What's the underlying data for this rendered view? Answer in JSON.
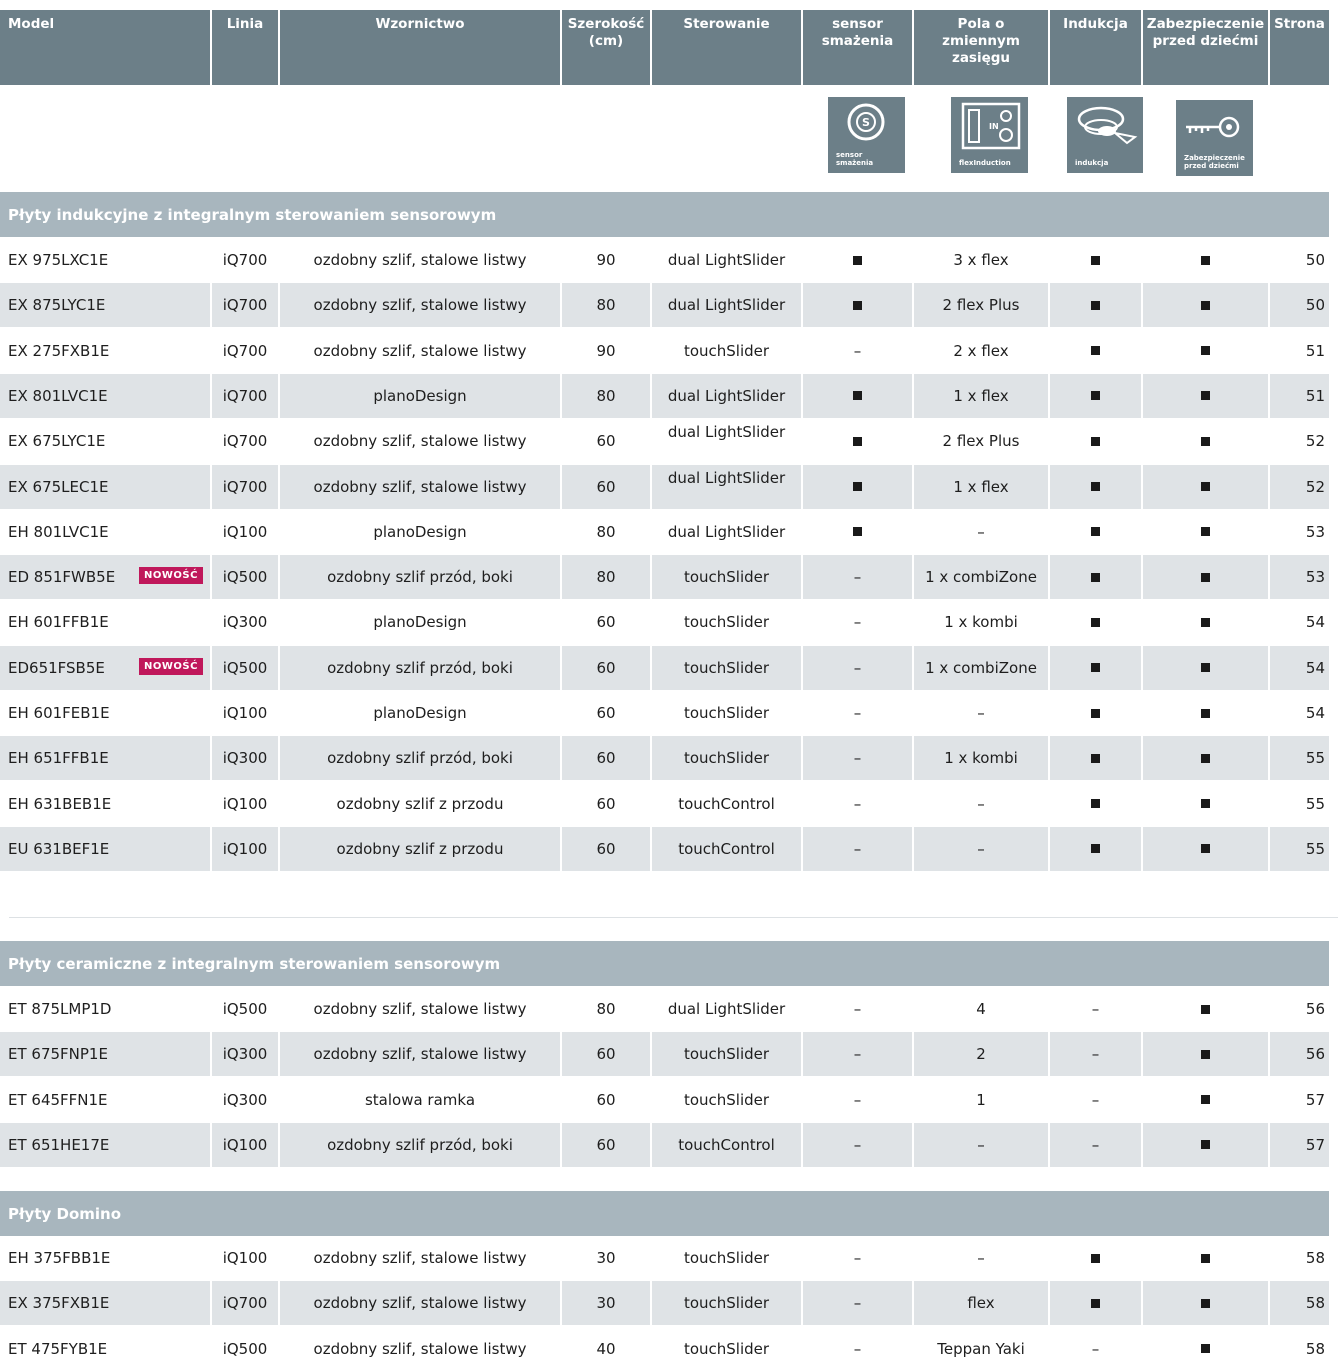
{
  "header": {
    "columns": [
      {
        "key": "model",
        "label": "Model"
      },
      {
        "key": "linia",
        "label": "Linia"
      },
      {
        "key": "wzornictwo",
        "label": "Wzornictwo"
      },
      {
        "key": "szerokosc",
        "label": "Szerokość (cm)"
      },
      {
        "key": "sterowanie",
        "label": "Sterowanie"
      },
      {
        "key": "sensor",
        "label": "sensor smażenia"
      },
      {
        "key": "pola",
        "label": "Pola o zmiennym zasięgu"
      },
      {
        "key": "indukcja",
        "label": "Indukcja"
      },
      {
        "key": "zabezpieczenie",
        "label": "Zabezpieczenie przed dziećmi"
      },
      {
        "key": "strona",
        "label": "Strona"
      }
    ]
  },
  "icons": {
    "sensor": {
      "icon": "sensor-smazenia-icon",
      "caption": "sensor smażenia"
    },
    "flex": {
      "icon": "flexinduction-icon",
      "caption": "flexInduction"
    },
    "indukcja": {
      "icon": "indukcja-icon",
      "caption": "indukcja"
    },
    "zabezpieczenie": {
      "icon": "key-lock-icon",
      "caption": "Zabezpieczenie przed dziećmi"
    }
  },
  "markers": {
    "yes": "■",
    "no": "–"
  },
  "badge_text": "NOWOŚĆ",
  "sections": [
    {
      "title": "Płyty indukcyjne z integralnym sterowaniem sensorowym",
      "rows": [
        {
          "model": "EX 975LXC1E",
          "linia": "iQ700",
          "wzornictwo": "ozdobny szlif, stalowe listwy",
          "szerokosc": "90",
          "sterowanie": "dual LightSlider",
          "sensor": "■",
          "pola": "3 x flex",
          "indukcja": "■",
          "zabezpieczenie": "■",
          "strona": "50"
        },
        {
          "model": "EX 875LYC1E",
          "linia": "iQ700",
          "wzornictwo": "ozdobny szlif, stalowe listwy",
          "szerokosc": "80",
          "sterowanie": "dual LightSlider",
          "sensor": "■",
          "pola": "2 flex Plus",
          "indukcja": "■",
          "zabezpieczenie": "■",
          "strona": "50"
        },
        {
          "model": "EX 275FXB1E",
          "linia": "iQ700",
          "wzornictwo": "ozdobny szlif, stalowe listwy",
          "szerokosc": "90",
          "sterowanie": "touchSlider",
          "sensor": "–",
          "pola": "2 x flex",
          "indukcja": "■",
          "zabezpieczenie": "■",
          "strona": "51"
        },
        {
          "model": "EX 801LVC1E",
          "linia": "iQ700",
          "wzornictwo": "planoDesign",
          "szerokosc": "80",
          "sterowanie": "dual LightSlider",
          "sensor": "■",
          "pola": "1 x flex",
          "indukcja": "■",
          "zabezpieczenie": "■",
          "strona": "51"
        },
        {
          "model": "EX 675LYC1E",
          "linia": "iQ700",
          "wzornictwo": "ozdobny szlif, stalowe listwy",
          "szerokosc": "60",
          "sterowanie": "dual LightSlider",
          "sensor": "■",
          "pola": "2 flex Plus",
          "indukcja": "■",
          "zabezpieczenie": "■",
          "strona": "52",
          "raised": true
        },
        {
          "model": "EX 675LEC1E",
          "linia": "iQ700",
          "wzornictwo": "ozdobny szlif, stalowe listwy",
          "szerokosc": "60",
          "sterowanie": "dual LightSlider",
          "sensor": "■",
          "pola": "1 x flex",
          "indukcja": "■",
          "zabezpieczenie": "■",
          "strona": "52",
          "raised": true
        },
        {
          "model": "EH 801LVC1E",
          "linia": "iQ100",
          "wzornictwo": "planoDesign",
          "szerokosc": "80",
          "sterowanie": "dual LightSlider",
          "sensor": "■",
          "pola": "–",
          "indukcja": "■",
          "zabezpieczenie": "■",
          "strona": "53"
        },
        {
          "model": "ED 851FWB5E",
          "linia": "iQ500",
          "wzornictwo": "ozdobny szlif przód, boki",
          "szerokosc": "80",
          "sterowanie": "touchSlider",
          "sensor": "–",
          "pola": "1 x combiZone",
          "indukcja": "■",
          "zabezpieczenie": "■",
          "strona": "53",
          "badge": true
        },
        {
          "model": "EH 601FFB1E",
          "linia": "iQ300",
          "wzornictwo": "planoDesign",
          "szerokosc": "60",
          "sterowanie": "touchSlider",
          "sensor": "–",
          "pola": "1 x kombi",
          "indukcja": "■",
          "zabezpieczenie": "■",
          "strona": "54"
        },
        {
          "model": "ED651FSB5E",
          "linia": "iQ500",
          "wzornictwo": "ozdobny szlif przód, boki",
          "szerokosc": "60",
          "sterowanie": "touchSlider",
          "sensor": "–",
          "pola": "1 x combiZone",
          "indukcja": "■",
          "zabezpieczenie": "■",
          "strona": "54",
          "badge": true
        },
        {
          "model": "EH 601FEB1E",
          "linia": "iQ100",
          "wzornictwo": "planoDesign",
          "szerokosc": "60",
          "sterowanie": "touchSlider",
          "sensor": "–",
          "pola": "–",
          "indukcja": "■",
          "zabezpieczenie": "■",
          "strona": "54"
        },
        {
          "model": "EH 651FFB1E",
          "linia": "iQ300",
          "wzornictwo": "ozdobny szlif przód, boki",
          "szerokosc": "60",
          "sterowanie": "touchSlider",
          "sensor": "–",
          "pola": "1 x kombi",
          "indukcja": "■",
          "zabezpieczenie": "■",
          "strona": "55"
        },
        {
          "model": "EH 631BEB1E",
          "linia": "iQ100",
          "wzornictwo": "ozdobny szlif z przodu",
          "szerokosc": "60",
          "sterowanie": "touchControl",
          "sensor": "–",
          "pola": "–",
          "indukcja": "■",
          "zabezpieczenie": "■",
          "strona": "55"
        },
        {
          "model": "EU 631BEF1E",
          "linia": "iQ100",
          "wzornictwo": "ozdobny szlif z przodu",
          "szerokosc": "60",
          "sterowanie": "touchControl",
          "sensor": "–",
          "pola": "–",
          "indukcja": "■",
          "zabezpieczenie": "■",
          "strona": "55"
        }
      ]
    },
    {
      "title": "Płyty ceramiczne z integralnym sterowaniem sensorowym",
      "rows": [
        {
          "model": "ET 875LMP1D",
          "linia": "iQ500",
          "wzornictwo": "ozdobny szlif, stalowe listwy",
          "szerokosc": "80",
          "sterowanie": "dual LightSlider",
          "sensor": "–",
          "pola": "4",
          "indukcja": "–",
          "zabezpieczenie": "■",
          "strona": "56"
        },
        {
          "model": "ET 675FNP1E",
          "linia": "iQ300",
          "wzornictwo": "ozdobny szlif, stalowe listwy",
          "szerokosc": "60",
          "sterowanie": "touchSlider",
          "sensor": "–",
          "pola": "2",
          "indukcja": "–",
          "zabezpieczenie": "■",
          "strona": "56"
        },
        {
          "model": "ET 645FFN1E",
          "linia": "iQ300",
          "wzornictwo": "stalowa ramka",
          "szerokosc": "60",
          "sterowanie": "touchSlider",
          "sensor": "–",
          "pola": "1",
          "indukcja": "–",
          "zabezpieczenie": "■",
          "strona": "57"
        },
        {
          "model": "ET 651HE17E",
          "linia": "iQ100",
          "wzornictwo": "ozdobny szlif przód, boki",
          "szerokosc": "60",
          "sterowanie": "touchControl",
          "sensor": "–",
          "pola": "–",
          "indukcja": "–",
          "zabezpieczenie": "■",
          "strona": "57"
        }
      ]
    },
    {
      "title": "Płyty Domino",
      "rows": [
        {
          "model": "EH 375FBB1E",
          "linia": "iQ100",
          "wzornictwo": "ozdobny szlif, stalowe listwy",
          "szerokosc": "30",
          "sterowanie": "touchSlider",
          "sensor": "–",
          "pola": "–",
          "indukcja": "■",
          "zabezpieczenie": "■",
          "strona": "58"
        },
        {
          "model": "EX 375FXB1E",
          "linia": "iQ700",
          "wzornictwo": "ozdobny szlif, stalowe listwy",
          "szerokosc": "30",
          "sterowanie": "touchSlider",
          "sensor": "–",
          "pola": "flex",
          "indukcja": "■",
          "zabezpieczenie": "■",
          "strona": "58"
        },
        {
          "model": "ET 475FYB1E",
          "linia": "iQ500",
          "wzornictwo": "ozdobny szlif, stalowe listwy",
          "szerokosc": "40",
          "sterowanie": "touchSlider",
          "sensor": "–",
          "pola": "Teppan Yaki",
          "indukcja": "–",
          "zabezpieczenie": "■",
          "strona": "58"
        }
      ]
    }
  ]
}
